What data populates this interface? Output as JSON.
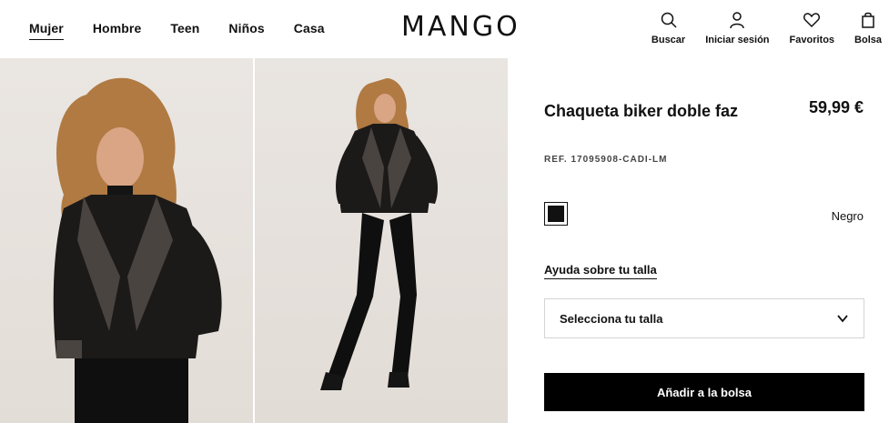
{
  "header": {
    "nav": [
      "Mujer",
      "Hombre",
      "Teen",
      "Niños",
      "Casa"
    ],
    "logo": "MANGO",
    "actions": {
      "search": "Buscar",
      "login": "Iniciar sesión",
      "favorites": "Favoritos",
      "bag": "Bolsa"
    }
  },
  "product": {
    "title": "Chaqueta biker doble faz",
    "price": "59,99 €",
    "ref": "REF. 17095908-CADI-LM",
    "color": "Negro",
    "size_help": "Ayuda sobre tu talla",
    "size_select": "Selecciona tu talla",
    "add_button": "Añadir a la bolsa"
  },
  "colors": {
    "swatch": "#111111",
    "background": "#ffffff"
  }
}
